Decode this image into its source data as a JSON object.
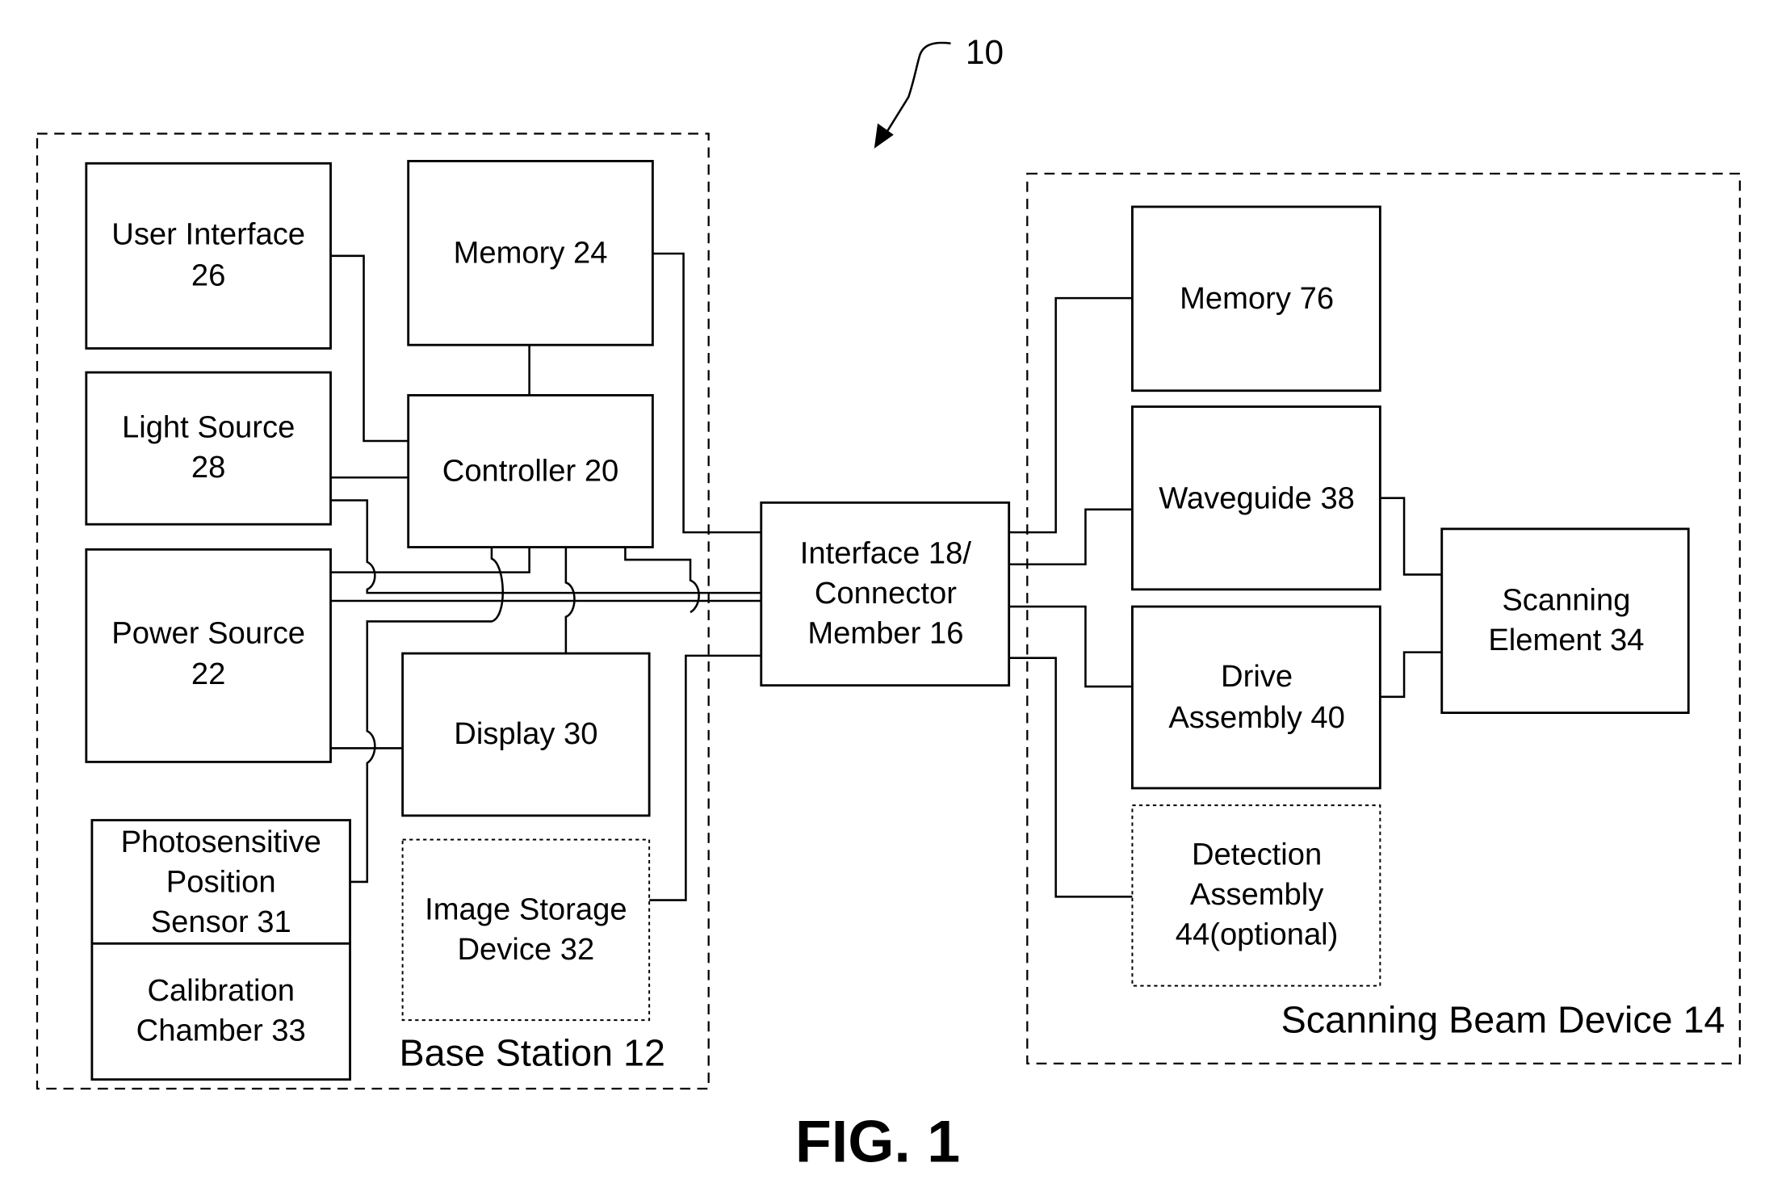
{
  "figure": {
    "caption": "FIG. 1",
    "reference_numeral": "10"
  },
  "groups": {
    "base_station": "Base Station 12",
    "scanning_beam_device": "Scanning Beam Device 14"
  },
  "blocks": {
    "user_interface": [
      "User Interface",
      "26"
    ],
    "memory24": [
      "Memory 24"
    ],
    "light_source": [
      "Light Source",
      "28"
    ],
    "controller": [
      "Controller 20"
    ],
    "power_source": [
      "Power Source",
      "22"
    ],
    "display": [
      "Display 30"
    ],
    "photosensor": [
      "Photosensitive",
      "Position",
      "Sensor 31"
    ],
    "calibration": [
      "Calibration",
      "Chamber 33"
    ],
    "image_storage": [
      "Image Storage",
      "Device 32"
    ],
    "interface": [
      "Interface 18/",
      "Connector",
      "Member 16"
    ],
    "memory76": [
      "Memory 76"
    ],
    "waveguide": [
      "Waveguide 38"
    ],
    "drive": [
      "Drive",
      "Assembly 40"
    ],
    "detection": [
      "Detection",
      "Assembly",
      "44(optional)"
    ],
    "scanning_element": [
      "Scanning",
      "Element 34"
    ]
  }
}
